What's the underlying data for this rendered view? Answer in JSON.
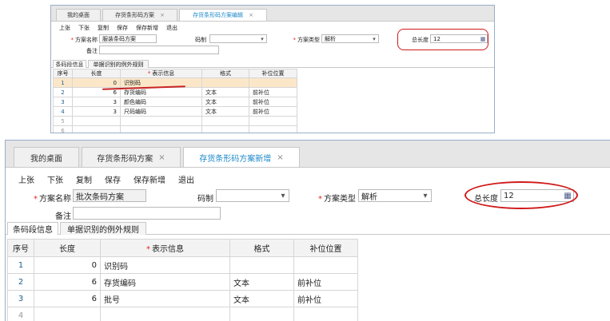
{
  "top_window": {
    "tabs": [
      {
        "label": "我的桌面",
        "closable": false
      },
      {
        "label": "存货条形码方案",
        "closable": true
      },
      {
        "label": "存货条形码方案编辑",
        "closable": true,
        "active": true
      }
    ],
    "close_glyph": "×",
    "toolbar": [
      "上张",
      "下张",
      "复制",
      "保存",
      "保存新增",
      "退出"
    ],
    "form": {
      "scheme_name_label": "方案名称",
      "scheme_name_value": "服装条码方案",
      "code_label": "码制",
      "code_value": "",
      "scheme_type_label": "方案类型",
      "scheme_type_value": "解析",
      "total_length_label": "总长度",
      "total_length_value": "12",
      "remark_label": "备注",
      "remark_value": "",
      "required_mark": "*"
    },
    "subtabs": [
      "条码段信息",
      "单据识别的例外规则"
    ],
    "table": {
      "headers": [
        "序号",
        "长度",
        "表示信息",
        "格式",
        "补位位置"
      ],
      "rows": [
        {
          "idx": "1",
          "length": "0",
          "info": "识别码",
          "format": "",
          "pad": ""
        },
        {
          "idx": "2",
          "length": "6",
          "info": "存货编码",
          "format": "文本",
          "pad": "前补位"
        },
        {
          "idx": "3",
          "length": "3",
          "info": "颜色编码",
          "format": "文本",
          "pad": "前补位"
        },
        {
          "idx": "4",
          "length": "3",
          "info": "尺码编码",
          "format": "文本",
          "pad": "前补位"
        },
        {
          "idx": "5",
          "length": "",
          "info": "",
          "format": "",
          "pad": ""
        },
        {
          "idx": "6",
          "length": "",
          "info": "",
          "format": "",
          "pad": ""
        }
      ]
    }
  },
  "bottom_window": {
    "tabs": [
      {
        "label": "我的桌面",
        "closable": false
      },
      {
        "label": "存货条形码方案",
        "closable": true
      },
      {
        "label": "存货条形码方案新增",
        "closable": true,
        "active": true
      }
    ],
    "close_glyph": "×",
    "toolbar": [
      "上张",
      "下张",
      "复制",
      "保存",
      "保存新增",
      "退出"
    ],
    "form": {
      "scheme_name_label": "方案名称",
      "scheme_name_value": "批次条码方案",
      "code_label": "码制",
      "code_value": "",
      "scheme_type_label": "方案类型",
      "scheme_type_value": "解析",
      "total_length_label": "总长度",
      "total_length_value": "12",
      "remark_label": "备注",
      "remark_value": "",
      "required_mark": "*"
    },
    "subtabs": [
      "条码段信息",
      "单据识别的例外规则"
    ],
    "table": {
      "headers": [
        "序号",
        "长度",
        "表示信息",
        "格式",
        "补位位置"
      ],
      "rows": [
        {
          "idx": "1",
          "length": "0",
          "info": "识别码",
          "format": "",
          "pad": ""
        },
        {
          "idx": "2",
          "length": "6",
          "info": "存货编码",
          "format": "文本",
          "pad": "前补位"
        },
        {
          "idx": "3",
          "length": "6",
          "info": "批号",
          "format": "文本",
          "pad": "前补位"
        },
        {
          "idx": "4",
          "length": "",
          "info": "",
          "format": "",
          "pad": ""
        }
      ]
    }
  },
  "icons": {
    "dropdown": "▾",
    "calculator": "▦"
  },
  "colors": {
    "active_tab_text": "#1d88c9",
    "required_star": "#e0261c",
    "annotation_red": "#d01a1a",
    "selected_row": "#fbe7c8"
  }
}
